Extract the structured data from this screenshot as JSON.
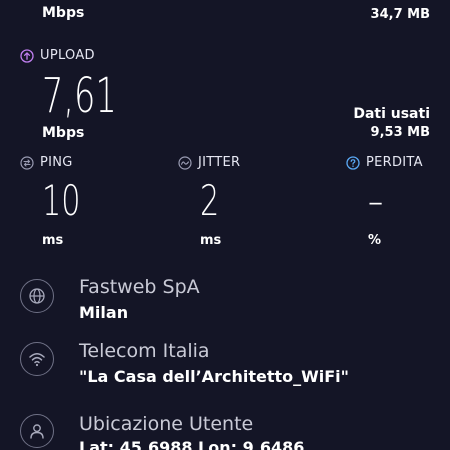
{
  "download": {
    "unit": "Mbps",
    "data_used_value": "34,7 MB"
  },
  "upload": {
    "label": "UPLOAD",
    "value": "7,61",
    "unit": "Mbps",
    "data_used_label": "Dati usati",
    "data_used_value": "9,53 MB"
  },
  "ping": {
    "label": "PING",
    "value": "10",
    "unit": "ms"
  },
  "jitter": {
    "label": "JITTER",
    "value": "2",
    "unit": "ms"
  },
  "loss": {
    "label": "PERDITA",
    "value": "–",
    "unit": "%"
  },
  "provider": {
    "name": "Fastweb SpA",
    "location": "Milan",
    "icon": "globe-icon"
  },
  "network": {
    "name": "Telecom Italia",
    "ssid": "\"La Casa dell’Architetto_WiFi\"",
    "icon": "wifi-icon"
  },
  "user_location": {
    "title": "Ubicazione Utente",
    "coords": "Lat: 45,6988 Lon: 9,6486",
    "icon": "user-icon"
  },
  "colors": {
    "background": "#141526",
    "upload_accent": "#c07ff0",
    "stat_icon": "#9a9cb3",
    "loss_icon": "#5aa9f5"
  }
}
